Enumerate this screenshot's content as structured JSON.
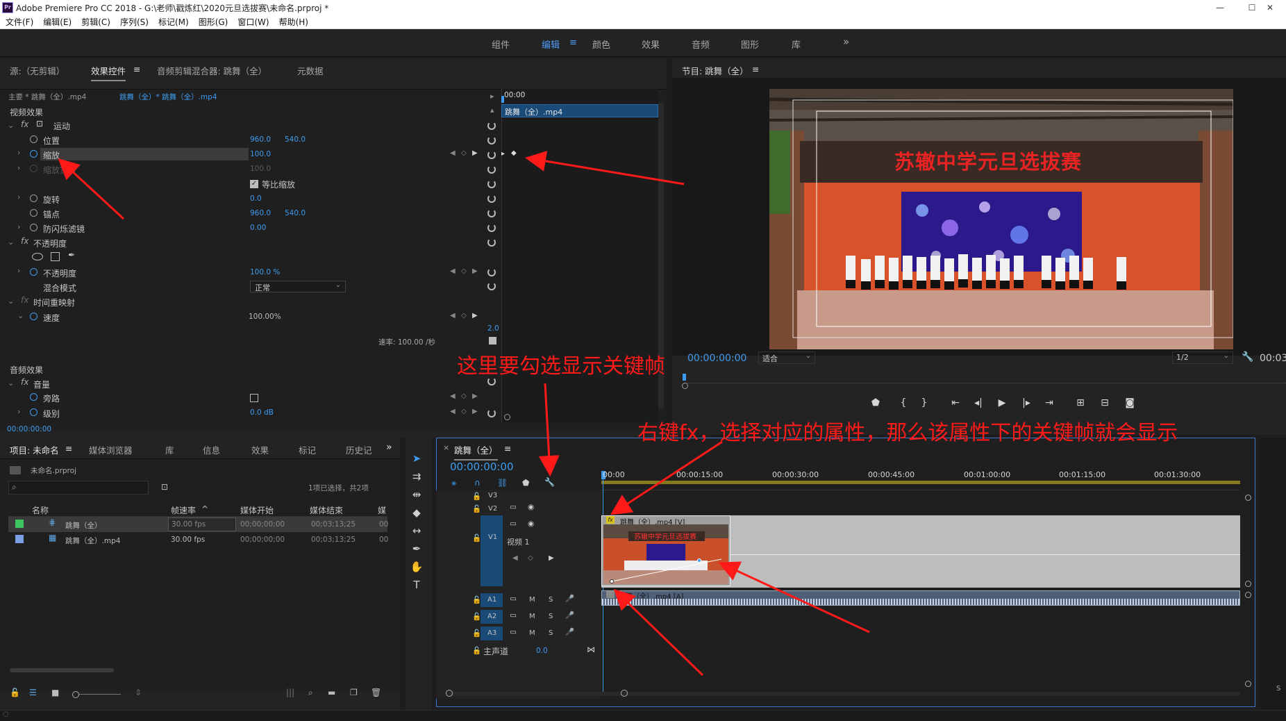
{
  "window": {
    "app_icon": "Pr",
    "title": "Adobe Premiere Pro CC 2018 - G:\\老师\\戳炼红\\2020元旦选拔赛\\未命名.prproj *"
  },
  "menu": [
    "文件(F)",
    "编辑(E)",
    "剪辑(C)",
    "序列(S)",
    "标记(M)",
    "图形(G)",
    "窗口(W)",
    "帮助(H)"
  ],
  "workspaces": [
    "组件",
    "编辑",
    "颜色",
    "效果",
    "音频",
    "图形",
    "库"
  ],
  "workspace_active_menu": "≡",
  "workspace_more": "»",
  "effect_controls": {
    "tabs": [
      "源:（无剪辑）",
      "效果控件",
      "音频剪辑混合器: 跳舞（全）",
      "元数据"
    ],
    "tab_menu": "≡",
    "clip_path_master": "主要 * 跳舞（全）.mp4",
    "clip_path_seq": "跳舞（全）* 跳舞（全）.mp4",
    "timecode_ruler": "00:00",
    "clip_bar_label": "跳舞（全）.mp4",
    "video_effects_header": "视频效果",
    "audio_effects_header": "音频效果",
    "motion": "运动",
    "position_label": "位置",
    "position_x": "960.0",
    "position_y": "540.0",
    "scale_label": "缩放",
    "scale_value": "100.0",
    "scale_width_label": "缩放宽度",
    "scale_width_value": "100.0",
    "uniform_scale_label": "等比缩放",
    "rotation_label": "旋转",
    "rotation_value": "0.0",
    "anchor_label": "锚点",
    "anchor_x": "960.0",
    "anchor_y": "540.0",
    "flicker_label": "防闪烁滤镜",
    "flicker_value": "0.00",
    "opacity_group": "不透明度",
    "opacity_label": "不透明度",
    "opacity_value": "100.0 %",
    "blend_label": "混合模式",
    "blend_value": "正常",
    "time_remap": "时间重映射",
    "speed_label": "速度",
    "speed_value": "100.00%",
    "graph_value": "2.0",
    "rate_label": "速率: 100.00 /秒",
    "volume_group": "音量",
    "bypass_label": "旁路",
    "level_label": "级别",
    "level_value": "0.0 dB",
    "current_time": "00:00:00:00"
  },
  "program_monitor": {
    "title": "节目: 跳舞（全）",
    "menu_glyph": "≡",
    "timecode": "00:00:00:00",
    "fit": "适合",
    "resolution": "1/2",
    "timecode_right": "00:03",
    "video_banner": "苏辙中学元旦选拔赛"
  },
  "project": {
    "tabs": [
      "项目: 未命名",
      "媒体浏览器",
      "库",
      "信息",
      "效果",
      "标记",
      "历史记"
    ],
    "more": "»",
    "file_name": "未命名.prproj",
    "selection_info": "1项已选择，共2项",
    "columns": [
      "名称",
      "帧速率",
      "媒体开始",
      "媒体结束",
      "媒"
    ],
    "rows": [
      {
        "swatch": "#3ec45e",
        "name": "跳舞（全）",
        "fps": "30.00 fps",
        "start": "00;00;00;00",
        "end": "00;03;13;25",
        "extra": "00"
      },
      {
        "swatch": "#7b9fe0",
        "name": "跳舞（全）.mp4",
        "fps": "30.00 fps",
        "start": "00;00;00;00",
        "end": "00;03;13;25",
        "extra": "00"
      }
    ]
  },
  "timeline": {
    "close": "×",
    "title": "跳舞（全）",
    "timecode": "00:00:00:00",
    "ruler": [
      "00:00",
      "00:00:15:00",
      "00:00:30:00",
      "00:00:45:00",
      "00:01:00:00",
      "00:01:15:00",
      "00:01:30:00"
    ],
    "tracks_video": [
      "V3",
      "V2",
      "V1"
    ],
    "tracks_audio": [
      "A1",
      "A2",
      "A3"
    ],
    "v1_name": "视频 1",
    "clip_video_label": "跳舞（全）.mp4 [V]",
    "clip_audio_label": "跳舞（全）.mp4 [A]",
    "fx_badge": "fx",
    "track_m": "M",
    "track_s": "S",
    "master_label": "主声道",
    "master_value": "0.0"
  },
  "annotations": {
    "keyframe_hint": "这里要勾选显示关键帧",
    "fx_hint": "右键fx，选择对应的属性，那么该属性下的关键帧就会显示"
  },
  "colors": {
    "accent_blue": "#3e9cf0",
    "annotation_red": "#ff1a1a",
    "track_blue": "#1a4a78",
    "banner_red": "#e82323"
  }
}
